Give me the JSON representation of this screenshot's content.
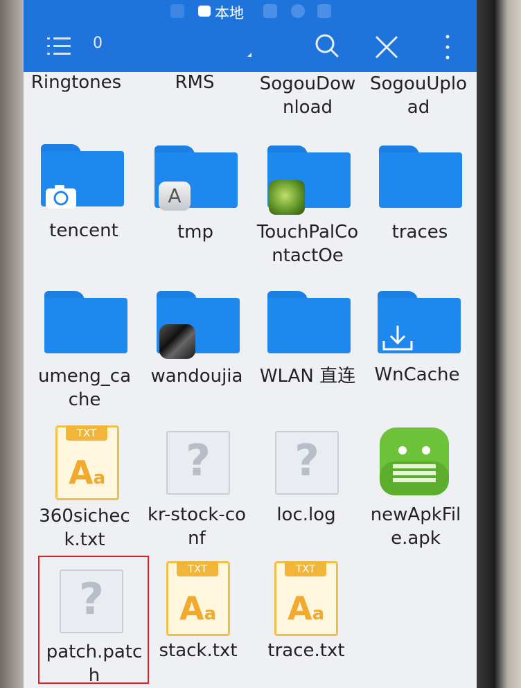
{
  "status_bar": {
    "title": "本地"
  },
  "toolbar": {
    "selection_count": "0"
  },
  "colors": {
    "accent": "#1f74dc",
    "folder": "#1f88ee",
    "highlight": "#e02020",
    "txt_badge": "#f1b53a"
  },
  "files": [
    {
      "name": "Ringtones",
      "kind": "folder"
    },
    {
      "name": "RMS",
      "kind": "folder"
    },
    {
      "name": "SogouDownload",
      "kind": "folder"
    },
    {
      "name": "SogouUpload",
      "kind": "folder"
    },
    {
      "name": "tencent",
      "kind": "folder",
      "badge": "camera-icon"
    },
    {
      "name": "tmp",
      "kind": "folder",
      "badge": "letter-a-app-icon"
    },
    {
      "name": "TouchPalContactOe",
      "kind": "folder",
      "badge": "touchpal-app-icon"
    },
    {
      "name": "traces",
      "kind": "folder"
    },
    {
      "name": "umeng_cache",
      "kind": "folder"
    },
    {
      "name": "wandoujia",
      "kind": "folder",
      "badge": "wandoujia-app-icon"
    },
    {
      "name": "WLAN 直连",
      "kind": "folder"
    },
    {
      "name": "WnCache",
      "kind": "folder",
      "badge": "download-icon"
    },
    {
      "name": "360sicheck.txt",
      "kind": "txt",
      "tag": "TXT"
    },
    {
      "name": "kr-stock-conf",
      "kind": "unknown"
    },
    {
      "name": "loc.log",
      "kind": "unknown"
    },
    {
      "name": "newApkFile.apk",
      "kind": "apk"
    },
    {
      "name": "patch.patch",
      "kind": "unknown",
      "highlighted": true
    },
    {
      "name": "stack.txt",
      "kind": "txt",
      "tag": "TXT"
    },
    {
      "name": "trace.txt",
      "kind": "txt",
      "tag": "TXT"
    }
  ]
}
